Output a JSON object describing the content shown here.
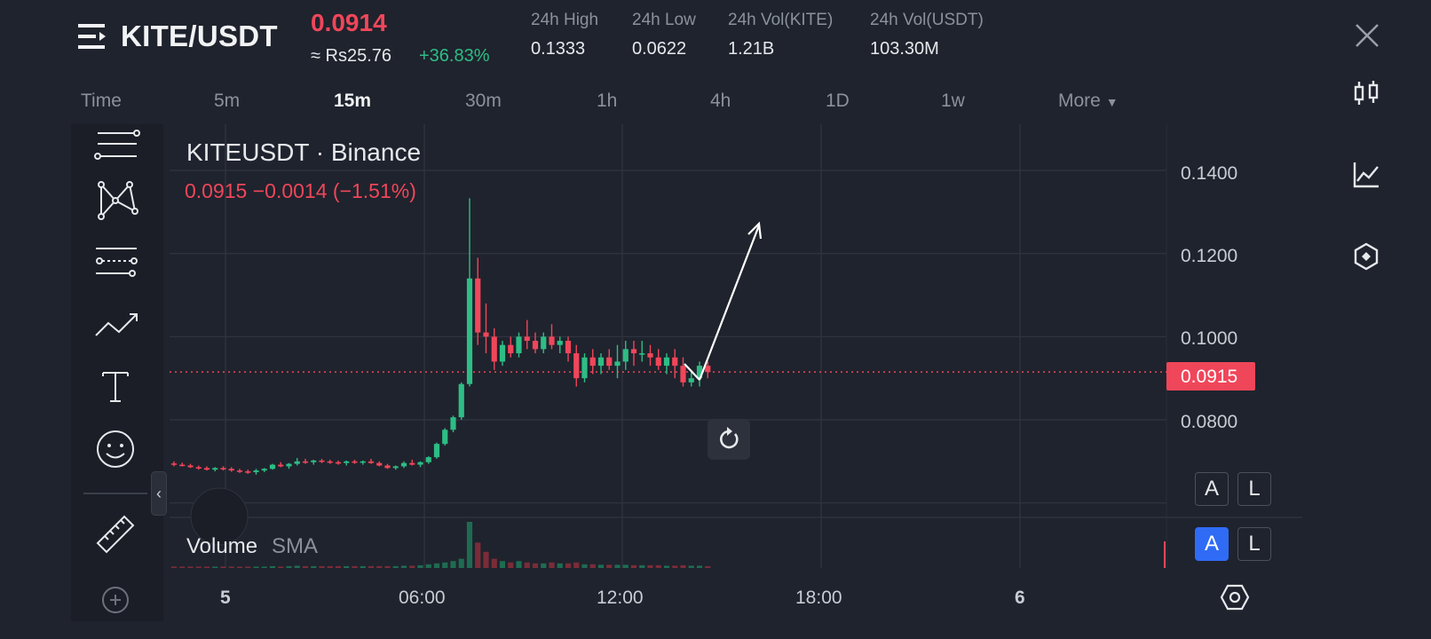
{
  "header": {
    "pair": "KITE/USDT",
    "last_price": "0.0914",
    "price_inr": "≈ Rs25.76",
    "change_pct": "+36.83%",
    "stats": [
      {
        "label": "24h High",
        "value": "0.1333"
      },
      {
        "label": "24h Low",
        "value": "0.0622"
      },
      {
        "label": "24h Vol(KITE)",
        "value": "1.21B"
      },
      {
        "label": "24h Vol(USDT)",
        "value": "103.30M"
      }
    ]
  },
  "intervals": {
    "items": [
      "Time",
      "5m",
      "15m",
      "30m",
      "1h",
      "4h",
      "1D",
      "1w",
      "More"
    ],
    "active": "15m"
  },
  "chart": {
    "symbol_title": "KITEUSDT · Binance",
    "ohlc_line": "0.0915  −0.0014 (−1.51%)",
    "current_price_tag": "0.0915",
    "volume_label": "Volume",
    "volume_ma_label": "SMA",
    "auto_label": "A",
    "log_label": "L"
  },
  "colors": {
    "up": "#2ebd85",
    "down": "#f0465a",
    "background": "#1f232d",
    "accent_blue": "#2f6bf5"
  },
  "icons": {
    "right_toolbar": [
      "candlestick-icon",
      "indicators-icon",
      "hexagon-settings-icon"
    ],
    "left_toolbar": [
      "lines-icon",
      "pattern-icon",
      "fib-icon",
      "trend-icon",
      "text-icon",
      "emoji-icon",
      "ruler-icon",
      "zoom-in-icon"
    ]
  },
  "chart_data": {
    "type": "candlestick",
    "y_ticks": [
      "0.1400",
      "0.1200",
      "0.1000",
      "0.0800"
    ],
    "x_ticks": [
      "5",
      "06:00",
      "12:00",
      "18:00",
      "6"
    ],
    "ylim": [
      0.068,
      0.147
    ],
    "grid": true,
    "candles_ohlc": [
      [
        0.0695,
        0.07,
        0.0688,
        0.0692
      ],
      [
        0.0692,
        0.0697,
        0.0688,
        0.069
      ],
      [
        0.069,
        0.0694,
        0.0684,
        0.0686
      ],
      [
        0.0686,
        0.069,
        0.068,
        0.0684
      ],
      [
        0.0684,
        0.0688,
        0.0678,
        0.068
      ],
      [
        0.068,
        0.0686,
        0.0676,
        0.0684
      ],
      [
        0.0684,
        0.0688,
        0.0678,
        0.0682
      ],
      [
        0.0682,
        0.0686,
        0.0675,
        0.0678
      ],
      [
        0.0678,
        0.0682,
        0.0672,
        0.0676
      ],
      [
        0.0676,
        0.068,
        0.067,
        0.0674
      ],
      [
        0.0674,
        0.0682,
        0.0668,
        0.0678
      ],
      [
        0.0678,
        0.0684,
        0.0674,
        0.0682
      ],
      [
        0.0682,
        0.0694,
        0.068,
        0.0692
      ],
      [
        0.0692,
        0.0698,
        0.0686,
        0.0688
      ],
      [
        0.0688,
        0.0696,
        0.0682,
        0.0694
      ],
      [
        0.0694,
        0.0708,
        0.069,
        0.07
      ],
      [
        0.07,
        0.0706,
        0.0694,
        0.0698
      ],
      [
        0.0698,
        0.0704,
        0.0692,
        0.0702
      ],
      [
        0.0702,
        0.0706,
        0.0696,
        0.07
      ],
      [
        0.07,
        0.0704,
        0.0694,
        0.0698
      ],
      [
        0.0698,
        0.0702,
        0.0692,
        0.0696
      ],
      [
        0.0696,
        0.0702,
        0.069,
        0.07
      ],
      [
        0.07,
        0.0704,
        0.0694,
        0.0698
      ],
      [
        0.0698,
        0.0702,
        0.0692,
        0.07
      ],
      [
        0.07,
        0.0706,
        0.0694,
        0.0696
      ],
      [
        0.0696,
        0.07,
        0.0688,
        0.069
      ],
      [
        0.069,
        0.0694,
        0.0682,
        0.0684
      ],
      [
        0.0684,
        0.069,
        0.068,
        0.0688
      ],
      [
        0.0688,
        0.07,
        0.0684,
        0.0696
      ],
      [
        0.0696,
        0.0704,
        0.069,
        0.0692
      ],
      [
        0.0692,
        0.07,
        0.0686,
        0.0698
      ],
      [
        0.0698,
        0.0712,
        0.0694,
        0.071
      ],
      [
        0.071,
        0.0745,
        0.0706,
        0.0742
      ],
      [
        0.0742,
        0.078,
        0.0738,
        0.0776
      ],
      [
        0.0776,
        0.081,
        0.077,
        0.0806
      ],
      [
        0.0806,
        0.089,
        0.08,
        0.0886
      ],
      [
        0.0886,
        0.1333,
        0.088,
        0.114
      ],
      [
        0.114,
        0.119,
        0.098,
        0.101
      ],
      [
        0.101,
        0.108,
        0.096,
        0.1
      ],
      [
        0.1,
        0.102,
        0.092,
        0.094
      ],
      [
        0.094,
        0.099,
        0.093,
        0.098
      ],
      [
        0.098,
        0.1,
        0.095,
        0.096
      ],
      [
        0.096,
        0.101,
        0.095,
        0.1
      ],
      [
        0.1,
        0.104,
        0.097,
        0.099
      ],
      [
        0.099,
        0.101,
        0.096,
        0.097
      ],
      [
        0.097,
        0.101,
        0.096,
        0.1
      ],
      [
        0.1,
        0.103,
        0.097,
        0.098
      ],
      [
        0.098,
        0.1,
        0.096,
        0.099
      ],
      [
        0.099,
        0.1,
        0.094,
        0.096
      ],
      [
        0.096,
        0.098,
        0.088,
        0.09
      ],
      [
        0.09,
        0.096,
        0.089,
        0.095
      ],
      [
        0.095,
        0.097,
        0.091,
        0.093
      ],
      [
        0.093,
        0.096,
        0.091,
        0.095
      ],
      [
        0.095,
        0.097,
        0.092,
        0.093
      ],
      [
        0.093,
        0.098,
        0.09,
        0.094
      ],
      [
        0.094,
        0.099,
        0.092,
        0.097
      ],
      [
        0.097,
        0.099,
        0.093,
        0.096
      ],
      [
        0.096,
        0.099,
        0.094,
        0.096
      ],
      [
        0.096,
        0.098,
        0.093,
        0.095
      ],
      [
        0.095,
        0.097,
        0.092,
        0.093
      ],
      [
        0.093,
        0.096,
        0.091,
        0.095
      ],
      [
        0.095,
        0.097,
        0.09,
        0.093
      ],
      [
        0.093,
        0.095,
        0.088,
        0.089
      ],
      [
        0.089,
        0.092,
        0.088,
        0.09
      ],
      [
        0.09,
        0.094,
        0.088,
        0.093
      ],
      [
        0.093,
        0.094,
        0.09,
        0.0915
      ]
    ],
    "volume_relative": [
      0.03,
      0.03,
      0.03,
      0.03,
      0.03,
      0.03,
      0.03,
      0.03,
      0.03,
      0.03,
      0.03,
      0.03,
      0.04,
      0.03,
      0.04,
      0.05,
      0.04,
      0.04,
      0.04,
      0.04,
      0.04,
      0.04,
      0.04,
      0.04,
      0.04,
      0.04,
      0.04,
      0.04,
      0.05,
      0.05,
      0.06,
      0.08,
      0.1,
      0.12,
      0.15,
      0.2,
      1.0,
      0.55,
      0.35,
      0.2,
      0.15,
      0.12,
      0.15,
      0.12,
      0.1,
      0.1,
      0.12,
      0.1,
      0.1,
      0.12,
      0.08,
      0.08,
      0.07,
      0.07,
      0.07,
      0.07,
      0.06,
      0.06,
      0.06,
      0.06,
      0.05,
      0.05,
      0.06,
      0.05,
      0.05,
      0.04
    ],
    "annotation": "arrow"
  }
}
